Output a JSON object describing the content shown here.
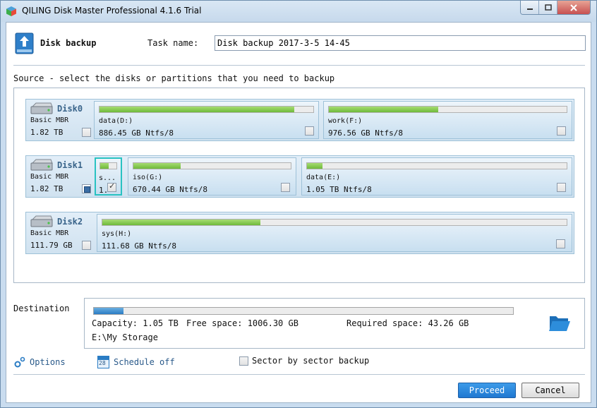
{
  "window": {
    "title": "QILING Disk Master Professional 4.1.6 Trial",
    "minimize_symbol": "—",
    "maximize_symbol": "□",
    "close_symbol": "✕"
  },
  "header": {
    "title": "Disk backup",
    "task_label": "Task name:",
    "task_value": "Disk backup 2017-3-5 14-45"
  },
  "source": {
    "label": "Source - select the disks or partitions that you need to backup",
    "disks": [
      {
        "name": "Disk0",
        "type": "Basic MBR",
        "size": "1.82 TB",
        "checked": false,
        "partitions": [
          {
            "label": "data(D:)",
            "info": "886.45 GB Ntfs/8",
            "used_fraction": 0.91,
            "checked": false
          },
          {
            "label": "work(F:)",
            "info": "976.56 GB Ntfs/8",
            "used_fraction": 0.46,
            "checked": false
          }
        ]
      },
      {
        "name": "Disk1",
        "type": "Basic MBR",
        "size": "1.82 TB",
        "checked": "partial",
        "partitions": [
          {
            "label": "s...",
            "info": "1.",
            "used_fraction": 0.5,
            "checked": true
          },
          {
            "label": "iso(G:)",
            "info": "670.44 GB Ntfs/8",
            "used_fraction": 0.3,
            "checked": false
          },
          {
            "label": "data(E:)",
            "info": "1.05 TB Ntfs/8",
            "used_fraction": 0.06,
            "checked": false
          }
        ]
      },
      {
        "name": "Disk2",
        "type": "Basic MBR",
        "size": "111.79 GB",
        "checked": false,
        "partitions": [
          {
            "label": "sys(H:)",
            "info": "111.68 GB Ntfs/8",
            "used_fraction": 0.34,
            "checked": false
          }
        ]
      }
    ]
  },
  "destination": {
    "label": "Destination",
    "used_fraction": 0.07,
    "capacity": "Capacity: 1.05 TB",
    "free": "Free space: 1006.30 GB",
    "required": "Required space: 43.26 GB",
    "path": "E:\\My Storage"
  },
  "options": {
    "options_label": "Options",
    "schedule_label": "Schedule off",
    "schedule_icon_text": "28",
    "sector_label": "Sector by sector backup"
  },
  "buttons": {
    "proceed": "Proceed",
    "cancel": "Cancel"
  },
  "colors": {
    "accent": "#1f78d1",
    "partition_bar": "#6eba3a",
    "destination_bar": "#2a7cc4",
    "selection": "#29c2c2"
  }
}
